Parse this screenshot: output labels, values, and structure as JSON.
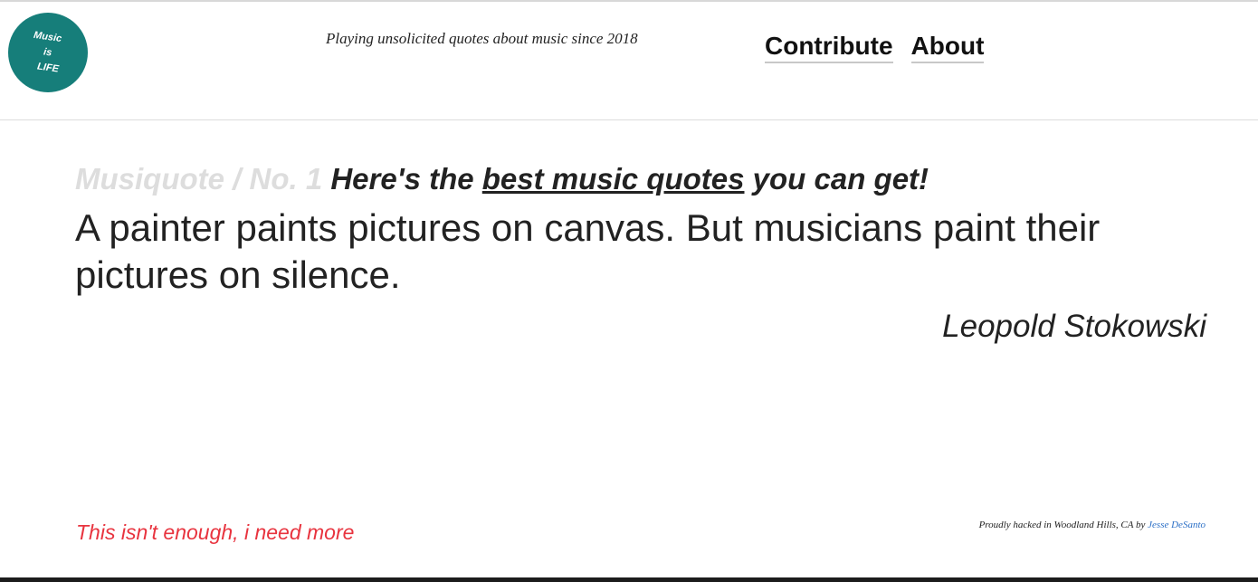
{
  "header": {
    "logo_lines": [
      "Music",
      "is",
      "LIFE"
    ],
    "tagline": "Playing unsolicited quotes about music since 2018",
    "nav": [
      {
        "label": "Contribute"
      },
      {
        "label": "About"
      }
    ]
  },
  "main": {
    "label": "Musiquote / No. 1",
    "intro_before": "Here's the",
    "intro_link": "best music quotes",
    "intro_after": "you can get!",
    "quote": "A painter paints pictures on canvas. But musicians paint their pictures on silence.",
    "author": "Leopold Stokowski"
  },
  "footer": {
    "more_link": "This isn't enough, i need more",
    "credit_text": "Proudly hacked in Woodland Hills, CA by",
    "credit_name": "Jesse DeSanto"
  },
  "colors": {
    "logo_bg": "#167e7a",
    "more_link": "#e8343f",
    "credit_link": "#2b6fc6",
    "label_gray": "#dddddd"
  }
}
